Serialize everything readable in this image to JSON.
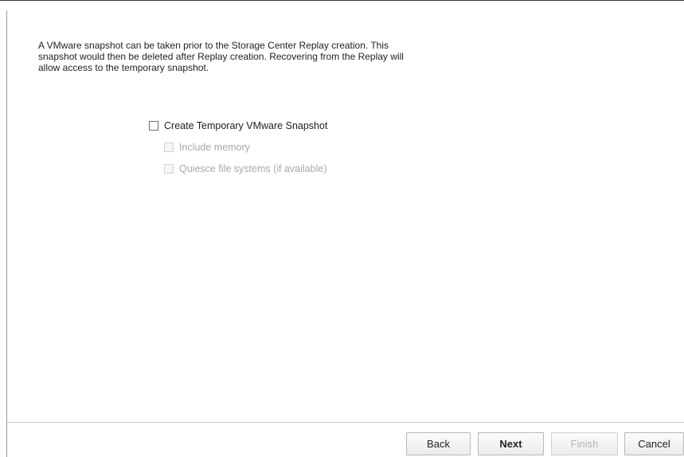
{
  "description": {
    "lines": [
      "A VMware snapshot can be taken prior to the Storage Center Replay creation. This",
      "snapshot would then be deleted after Replay creation. Recovering from the Replay will",
      "allow access to the temporary snapshot."
    ]
  },
  "options": {
    "create_snapshot": {
      "label": "Create Temporary VMware Snapshot",
      "checked": false,
      "enabled": true
    },
    "include_memory": {
      "label": "Include memory",
      "checked": false,
      "enabled": false
    },
    "quiesce": {
      "label": "Quiesce file systems (if available)",
      "checked": false,
      "enabled": false
    }
  },
  "buttons": {
    "back": "Back",
    "next": "Next",
    "finish": "Finish",
    "cancel": "Cancel"
  }
}
